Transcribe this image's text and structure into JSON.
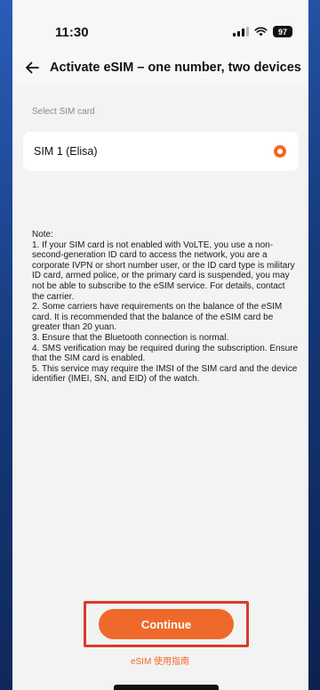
{
  "status_bar": {
    "time": "11:30",
    "battery": "97",
    "signal_icon": "signal-icon",
    "wifi_icon": "wifi-icon"
  },
  "header": {
    "back_icon": "back-arrow-icon",
    "title": "Activate eSIM – one number, two devices"
  },
  "sim_section": {
    "label": "Select SIM card",
    "options": [
      {
        "name": "SIM 1 (Elisa)",
        "selected": true
      }
    ]
  },
  "note": {
    "lines": [
      "Note:",
      "1. If your SIM card is not enabled with VoLTE, you use a non-second-generation ID card to access the network, you are a corporate IVPN or short number user, or the ID card type is military ID card, armed police, or the primary card is suspended, you may not be able to subscribe to the eSIM service. For details, contact the carrier.",
      "2. Some carriers have requirements on the balance of the eSIM card. It is recommended that the balance of the eSIM card be greater than 20 yuan.",
      "3. Ensure that the Bluetooth connection is normal.",
      "4. SMS verification may be required during the subscription. Ensure that the SIM card is enabled.",
      "5. This service may require the IMSI of the SIM card and the device identifier (IMEI, SN, and EID) of the watch."
    ]
  },
  "footer": {
    "continue_label": "Continue",
    "guide_link": "eSIM 使用指南"
  },
  "colors": {
    "accent": "#ef6a2a",
    "highlight_border": "#d83a2e",
    "backdrop": "#1b3f86"
  }
}
